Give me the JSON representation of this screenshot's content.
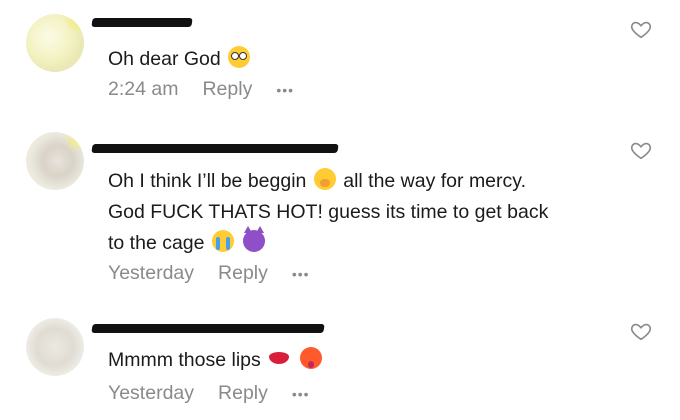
{
  "comments": [
    {
      "text_parts": [
        "Oh dear God",
        ""
      ],
      "emojis": [
        "flushed-face"
      ],
      "time": "2:24 am",
      "reply_label": "Reply",
      "more_label": "•••"
    },
    {
      "line1_a": "Oh I think I’ll be beggin",
      "line1_b": "all the way for mercy.",
      "line2": "God FUCK THATS HOT! guess its time to get back",
      "line3": "to the cage",
      "emojis": [
        "face-with-hand-over-mouth",
        "loudly-crying-face",
        "smiling-face-with-horns"
      ],
      "time": "Yesterday",
      "reply_label": "Reply",
      "more_label": "•••"
    },
    {
      "text": "Mmmm those lips",
      "emojis": [
        "kiss-mark",
        "hot-face"
      ],
      "time": "Yesterday",
      "reply_label": "Reply",
      "more_label": "•••"
    }
  ],
  "icons": {
    "like": "heart-outline-icon",
    "avatar": "profile-photo"
  },
  "colors": {
    "text": "#1b1b1b",
    "meta": "#8a8a8a",
    "redaction": "#111111",
    "background": "#ffffff"
  }
}
